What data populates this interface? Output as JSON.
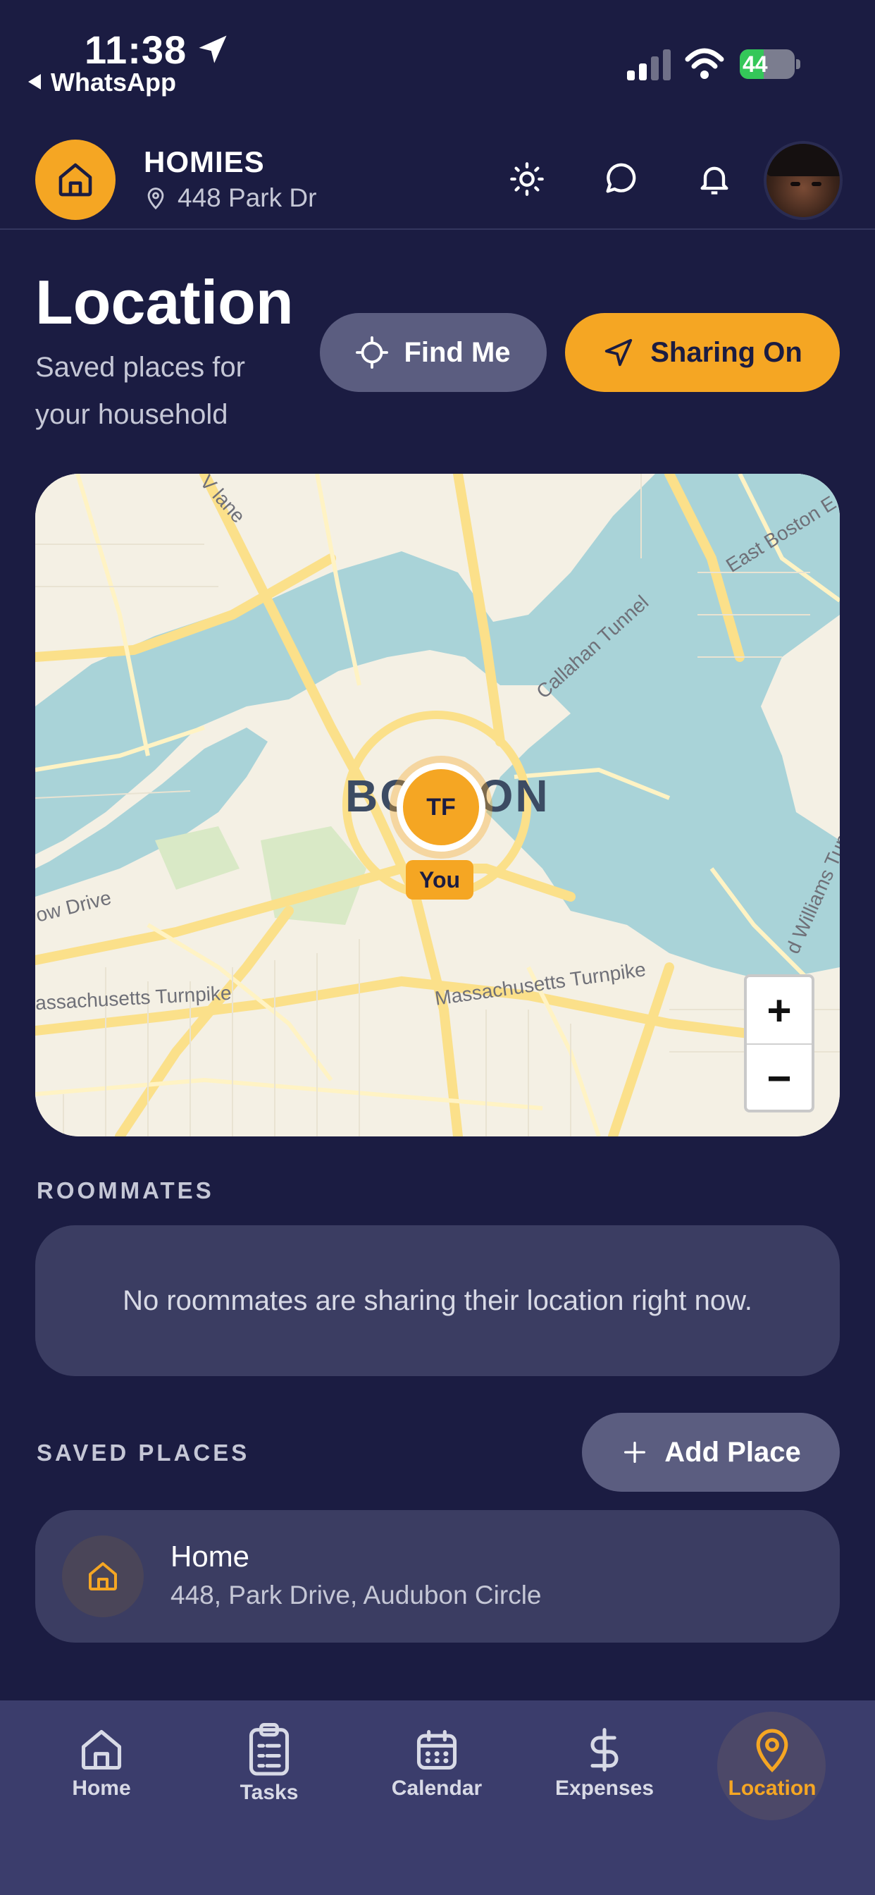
{
  "status_bar": {
    "time": "11:38",
    "back_app": "WhatsApp",
    "battery": "44",
    "battery_level": 0.44
  },
  "header": {
    "household_name": "HOMIES",
    "address": "448 Park Dr",
    "icons": [
      "sun-icon",
      "chat-icon",
      "bell-icon"
    ]
  },
  "page": {
    "title": "Location",
    "subtitle": "Saved places for your household",
    "find_me_label": "Find Me",
    "sharing_label": "Sharing On"
  },
  "map": {
    "city_label": "BOSTON",
    "labels": [
      "V lane",
      "East Boston E",
      "Callahan Tunnel",
      "ow Drive",
      "assachusetts Turnpike",
      "Massachusetts Turnpike",
      "d Williams Tun"
    ],
    "marker_initials": "TF",
    "marker_tag": "You",
    "zoom_in": "+",
    "zoom_out": "−"
  },
  "roommates": {
    "section_label": "ROOMMATES",
    "empty_message": "No roommates are sharing their location right now."
  },
  "saved_places": {
    "section_label": "SAVED PLACES",
    "add_label": "Add Place",
    "items": [
      {
        "name": "Home",
        "address": "448, Park Drive, Audubon Circle"
      }
    ]
  },
  "tabbar": {
    "tabs": [
      {
        "label": "Home",
        "icon": "home-icon"
      },
      {
        "label": "Tasks",
        "icon": "clipboard-icon"
      },
      {
        "label": "Calendar",
        "icon": "calendar-icon"
      },
      {
        "label": "Expenses",
        "icon": "dollar-icon"
      },
      {
        "label": "Location",
        "icon": "map-pin-icon"
      }
    ],
    "active": "Location"
  },
  "colors": {
    "background": "#1b1c42",
    "accent": "#f5a623",
    "card": "#3b3d62",
    "tabbar": "#3b3d6c"
  }
}
